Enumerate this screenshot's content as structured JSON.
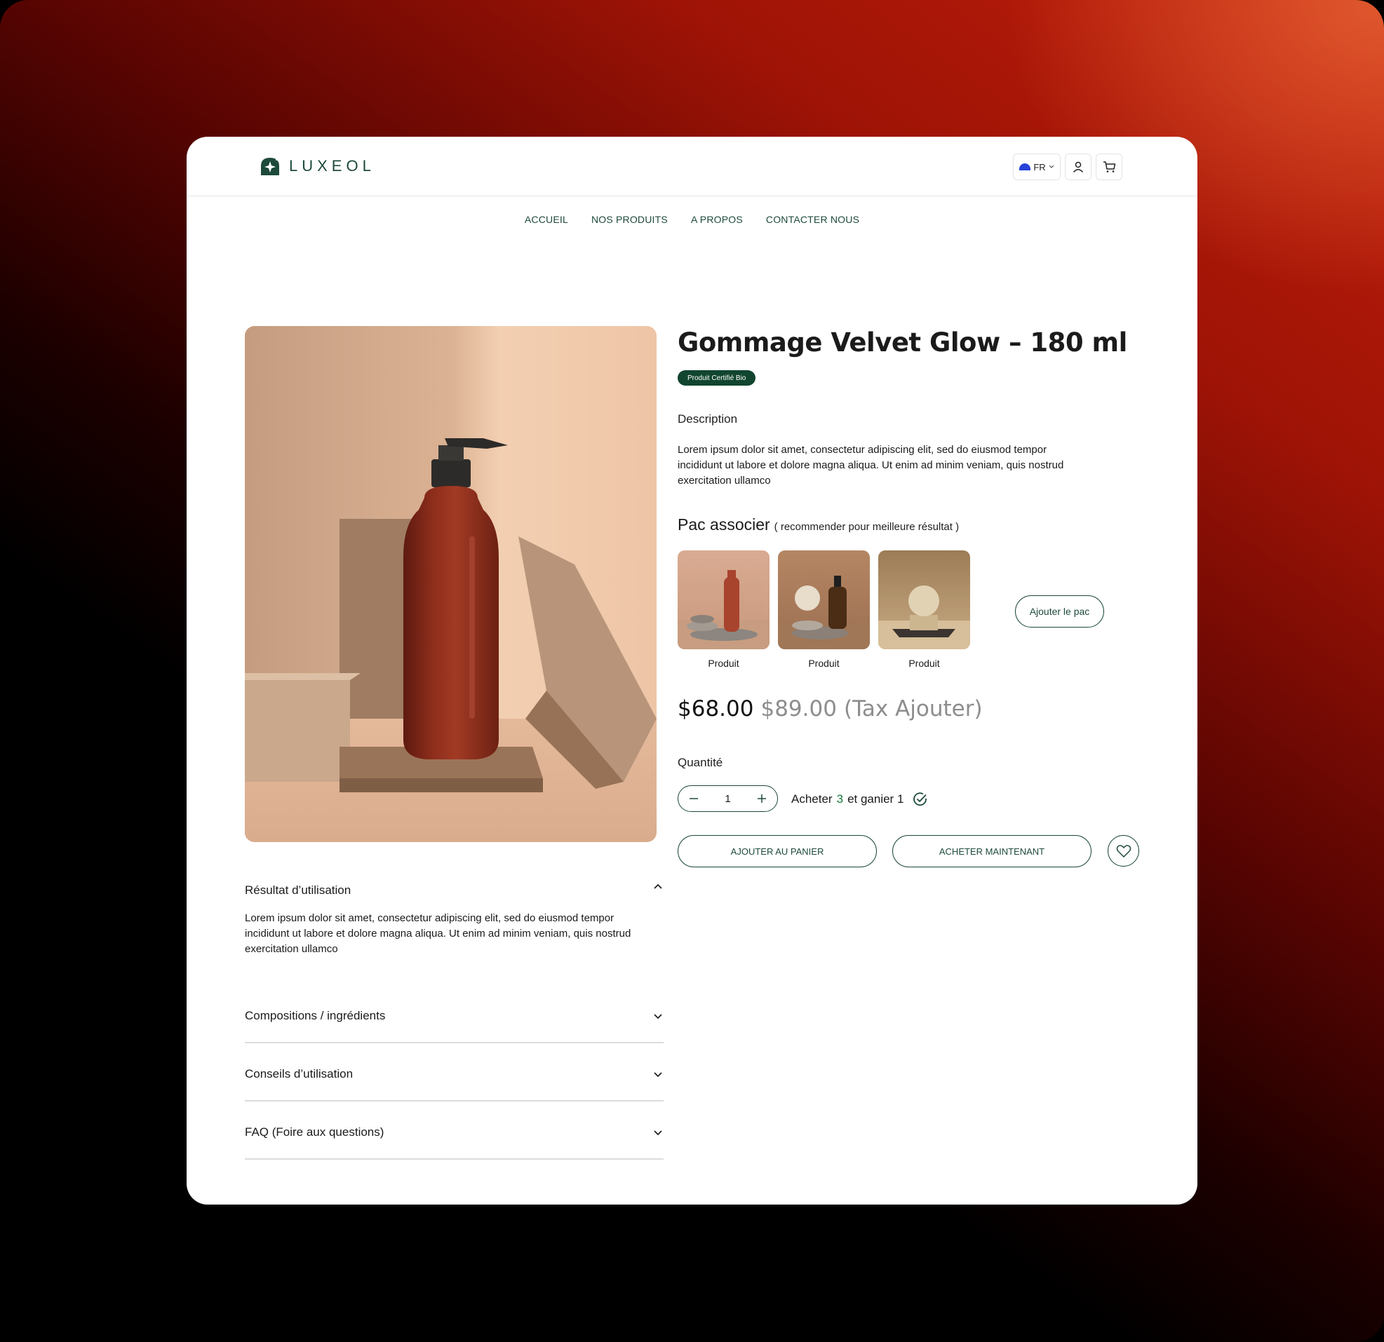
{
  "brand": {
    "name": "LUXEOL"
  },
  "header": {
    "language": "FR"
  },
  "nav": [
    "ACCUEIL",
    "NOS PRODUITS",
    "A PROPOS",
    "CONTACTER NOUS"
  ],
  "product": {
    "title": "Gommage Velvet Glow – 180 ml",
    "badge": "Produit Certifié Bio",
    "description_label": "Description",
    "description": "Lorem ipsum dolor sit amet, consectetur adipiscing elit, sed do eiusmod tempor incididunt ut labore et dolore magna aliqua. Ut enim ad minim veniam, quis nostrud exercitation ullamco",
    "price_now": "$68.00",
    "price_old": "$89.00",
    "price_note": "(Tax Ajouter)"
  },
  "pac": {
    "title": "Pac associer",
    "subtitle": "( recommender pour meilleure résultat )",
    "items": [
      "Produit",
      "Produit",
      "Produit"
    ],
    "add_label": "Ajouter le pac"
  },
  "quantity": {
    "label": "Quantité",
    "value": "1",
    "promo_prefix": "Acheter",
    "promo_highlight": "3",
    "promo_suffix": "et ganier 1"
  },
  "actions": {
    "add_to_cart": "AJOUTER AU  PANIER",
    "buy_now": "ACHETER MAINTENANT"
  },
  "accordions": {
    "open": {
      "title": "Résultat d’utilisation",
      "body": "Lorem ipsum dolor sit amet, consectetur adipiscing elit, sed do eiusmod tempor incididunt ut labore et dolore magna aliqua. Ut enim ad minim veniam, quis nostrud exercitation ullamco"
    },
    "closed": [
      "Compositions / ingrédients",
      "Conseils d’utilisation",
      "FAQ (Foire aux questions)"
    ]
  },
  "colors": {
    "brand_green": "#1d4a3a",
    "badge_green": "#11452f",
    "bottle": "#8b2a1a"
  }
}
